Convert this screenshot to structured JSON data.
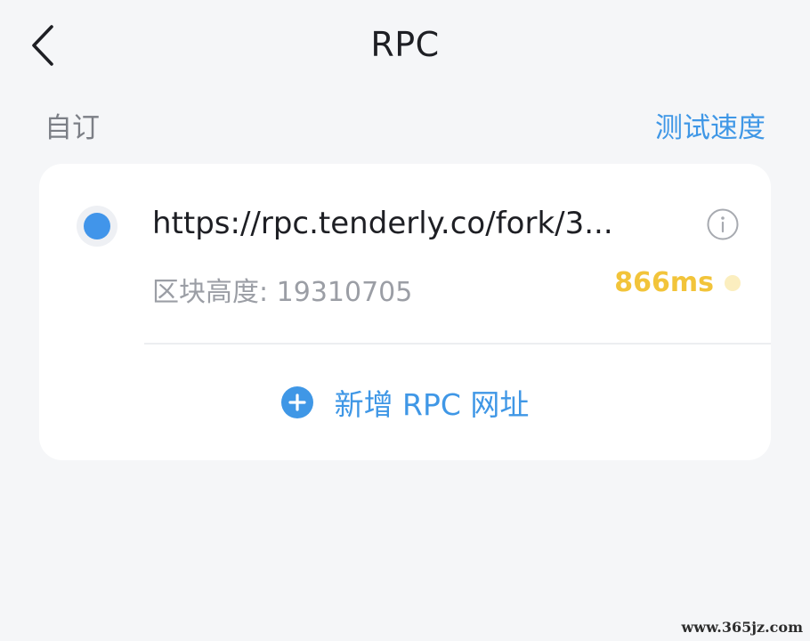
{
  "header": {
    "title": "RPC",
    "back_icon": "chevron-left-icon"
  },
  "section": {
    "label": "自订",
    "speed_test_label": "测试速度"
  },
  "rpc_list": [
    {
      "url": "https://rpc.tenderly.co/fork/3...",
      "block_height": "区块高度: 19310705",
      "latency": "866ms",
      "selected": true,
      "info_icon": "info-circle-icon"
    }
  ],
  "add_rpc": {
    "label": "新增 RPC 网址",
    "icon": "plus-circle-icon"
  },
  "watermark": "www.365jz.com",
  "colors": {
    "background": "#f5f6f8",
    "card": "#ffffff",
    "accent": "#3f97e6",
    "radio": "#4195ea",
    "latency": "#f2c43a",
    "title": "#1e1f24",
    "muted": "#9b9ea5"
  }
}
